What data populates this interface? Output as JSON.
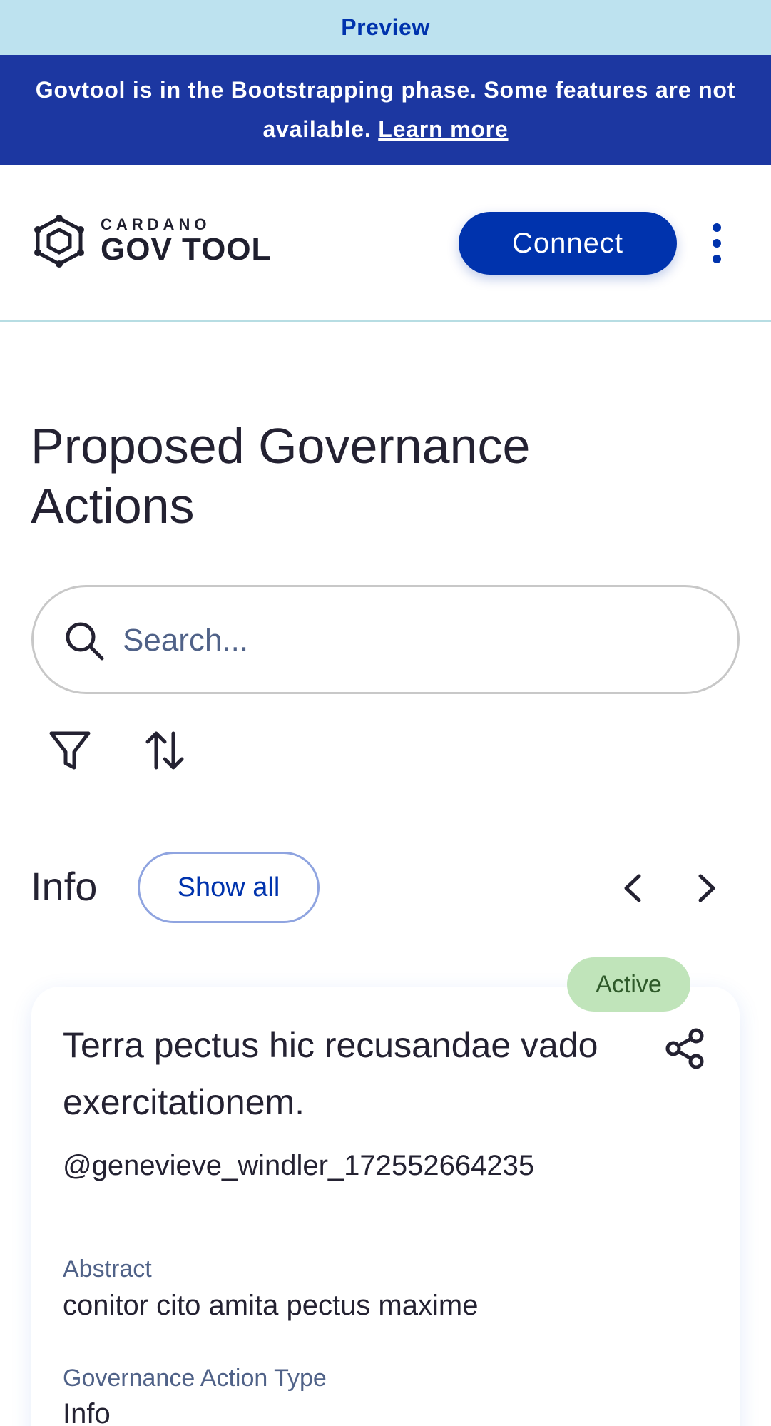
{
  "preview_bar": {
    "label": "Preview"
  },
  "bootstrap_banner": {
    "message": "Govtool is in the Bootstrapping phase. Some features are not available.",
    "link_label": "Learn more"
  },
  "header": {
    "logo_top": "CARDANO",
    "logo_main": "GOV TOOL",
    "connect_label": "Connect",
    "menu_icon": "vertical-dots-icon"
  },
  "page": {
    "title": "Proposed Governance Actions"
  },
  "search": {
    "placeholder": "Search..."
  },
  "toolbar": {
    "filter_icon": "filter-icon",
    "sort_icon": "sort-icon"
  },
  "section": {
    "label": "Info",
    "show_all_label": "Show all"
  },
  "card": {
    "status": "Active",
    "title": "Terra pectus hic recusandae vado exercitationem.",
    "author": "@genevieve_windler_172552664235",
    "abstract_label": "Abstract",
    "abstract_value": "conitor cito amita pectus maxime",
    "type_label": "Governance Action Type",
    "type_value": "Info"
  },
  "colors": {
    "primary": "#0033ad",
    "banner": "#1c37a1",
    "preview": "#bde2ef",
    "active_badge": "#c0e4ba"
  }
}
